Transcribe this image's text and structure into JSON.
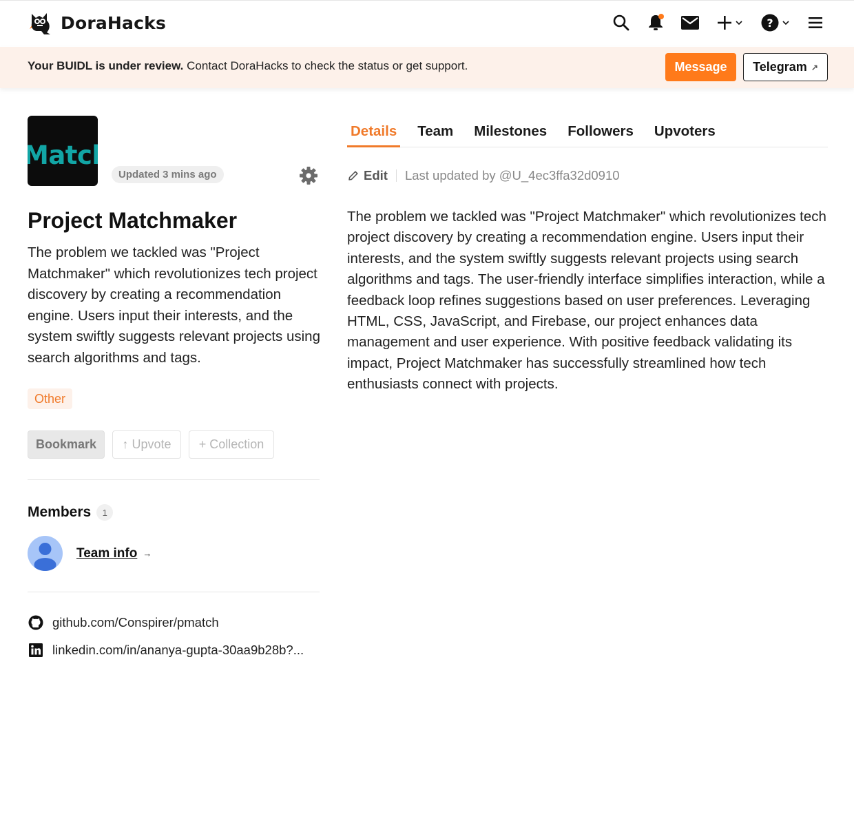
{
  "header": {
    "brand": "DoraHacks"
  },
  "banner": {
    "bold_text": "Your BUIDL is under review.",
    "text": " Contact DoraHacks to check the status or get support.",
    "message_label": "Message",
    "telegram_label": "Telegram",
    "accent_color": "#ff7a1a"
  },
  "project": {
    "thumb_text": "Match",
    "updated": "Updated 3 mins ago",
    "title": "Project Matchmaker",
    "summary": "The problem we tackled was \"Project Matchmaker\" which revolutionizes tech project discovery by creating a recommendation engine. Users input their interests, and the system swiftly suggests relevant projects using search algorithms and tags.",
    "tag": "Other",
    "actions": {
      "bookmark": "Bookmark",
      "upvote": "↑ Upvote",
      "collection": "+ Collection"
    }
  },
  "members": {
    "title": "Members",
    "count": "1",
    "team_info": "Team info",
    "arrow": "→"
  },
  "links": [
    {
      "icon": "github-icon",
      "text": "github.com/Conspirer/pmatch"
    },
    {
      "icon": "linkedin-icon",
      "text": "linkedin.com/in/ananya-gupta-30aa9b28b?..."
    }
  ],
  "tabs": [
    {
      "label": "Details",
      "active": true
    },
    {
      "label": "Team",
      "active": false
    },
    {
      "label": "Milestones",
      "active": false
    },
    {
      "label": "Followers",
      "active": false
    },
    {
      "label": "Upvoters",
      "active": false
    }
  ],
  "details": {
    "edit_label": "Edit",
    "last_updated": "Last updated by @U_4ec3ffa32d0910",
    "body": "The problem we tackled was \"Project Matchmaker\" which revolutionizes tech project discovery by creating a recommendation engine. Users input their interests, and the system swiftly suggests relevant projects using search algorithms and tags. The user-friendly interface simplifies interaction, while a feedback loop refines suggestions based on user preferences. Leveraging HTML, CSS, JavaScript, and Firebase, our project enhances data management and user experience. With positive feedback validating its impact, Project Matchmaker has successfully streamlined how tech enthusiasts connect with projects."
  }
}
